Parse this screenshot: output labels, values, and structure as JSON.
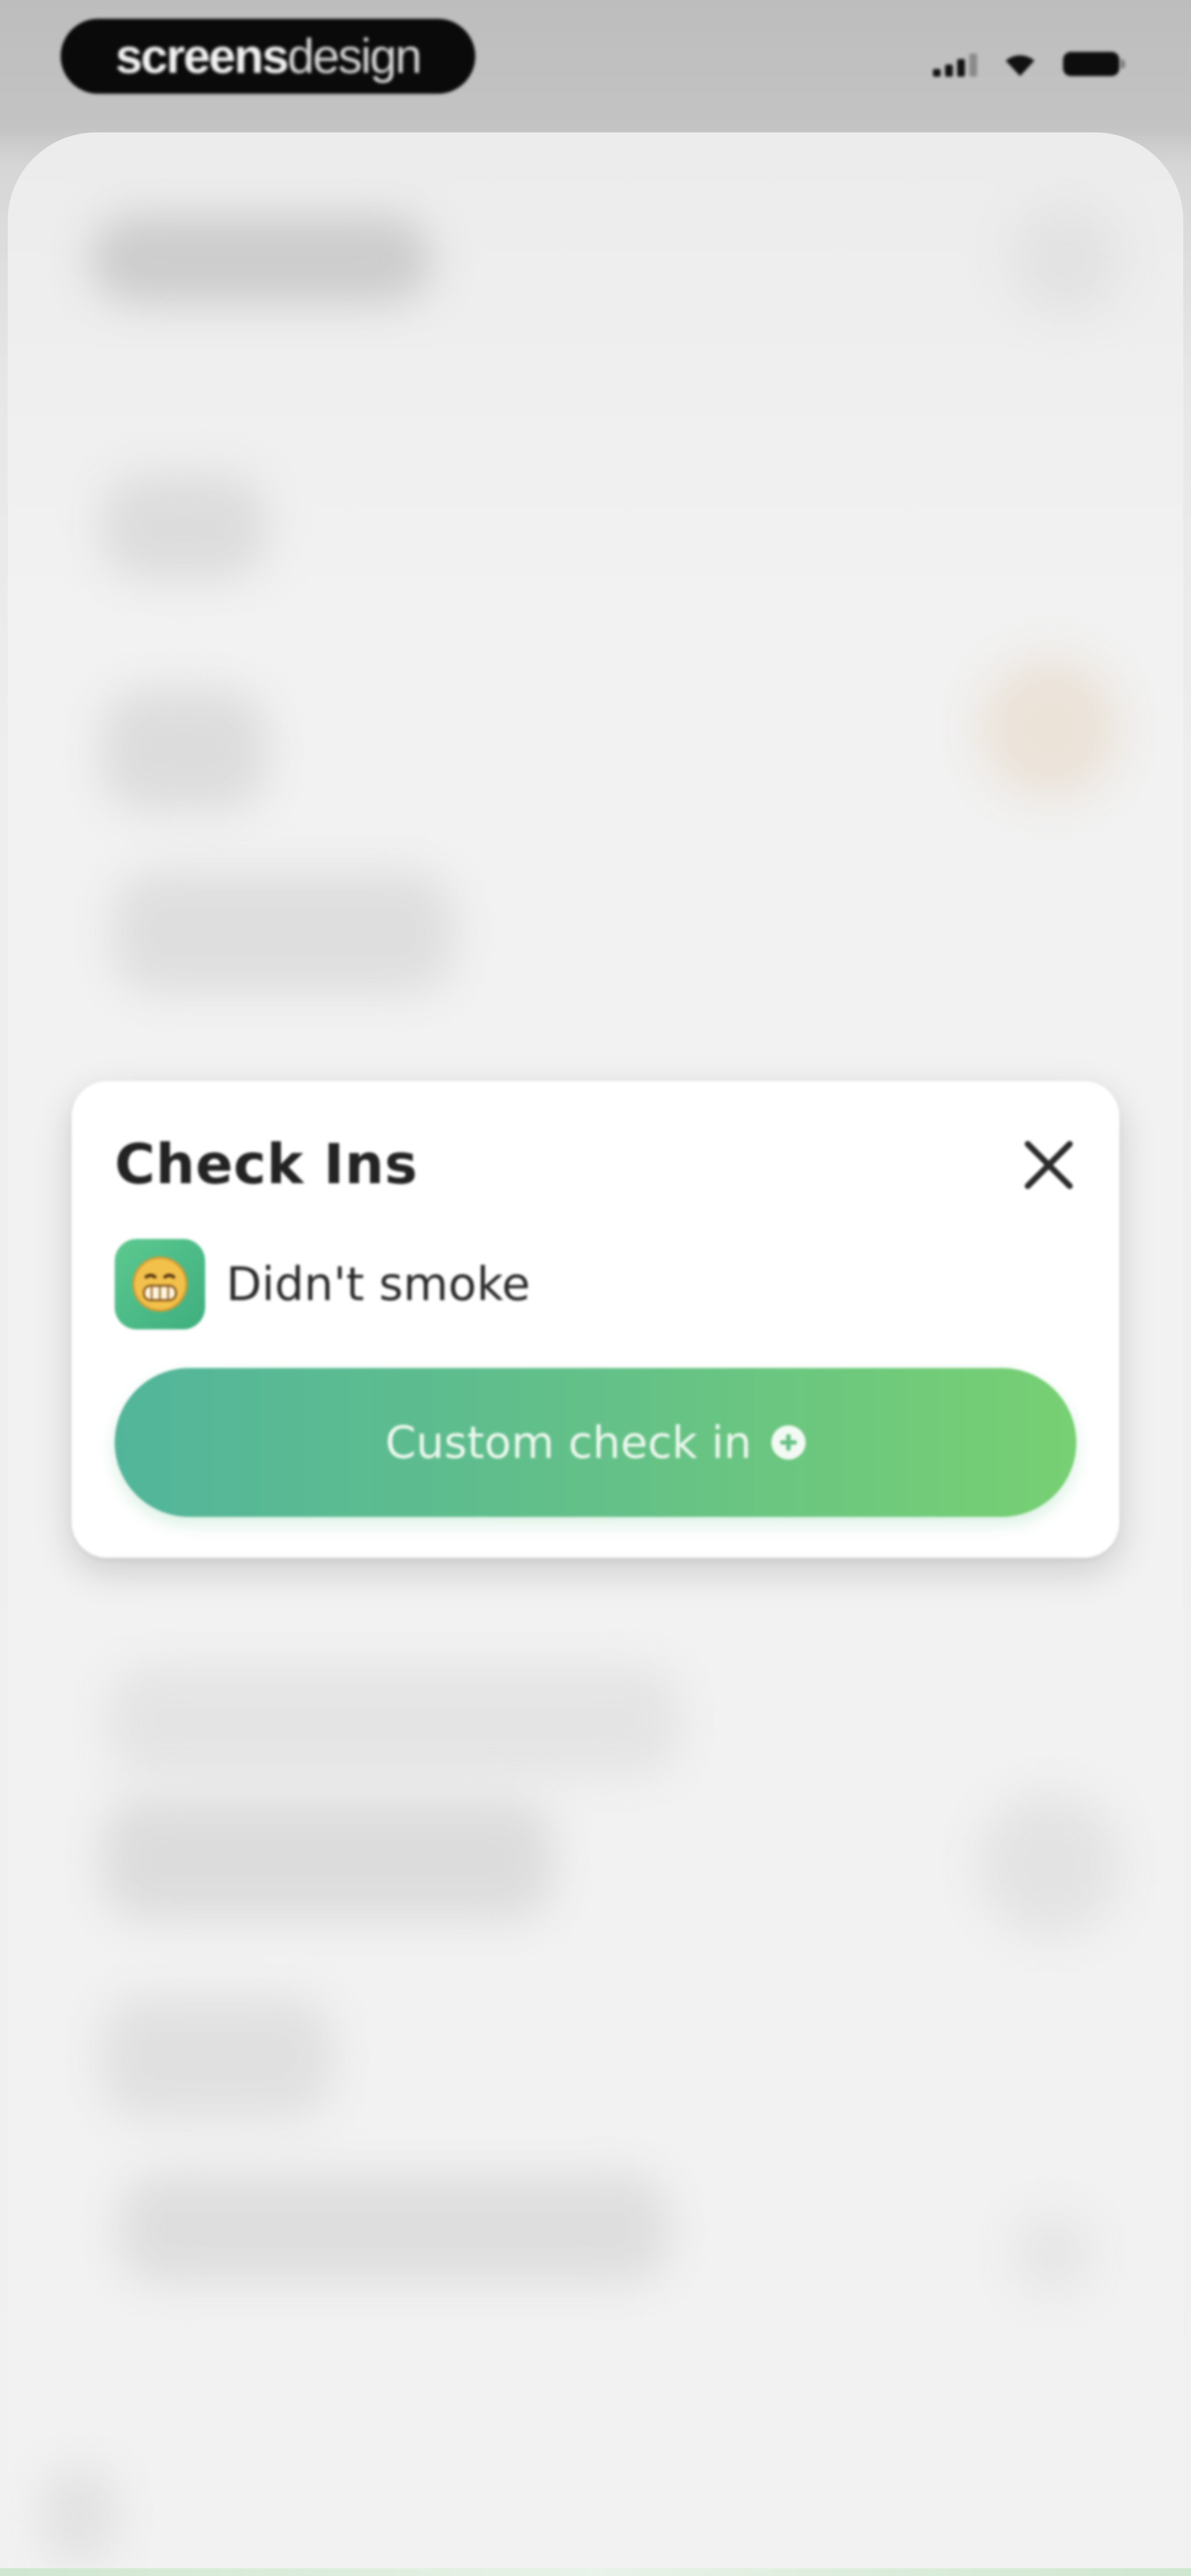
{
  "status_bar": {
    "brand_bold": "screens",
    "brand_light": "design",
    "icons": [
      "signal-icon",
      "wifi-icon",
      "battery-icon"
    ]
  },
  "modal": {
    "title": "Check Ins",
    "close_icon": "close-icon",
    "items": [
      {
        "label": "Didn't smoke",
        "icon": "grimace-emoji-icon"
      }
    ],
    "custom_button_label": "Custom check in",
    "custom_button_icon": "plus-circle-icon"
  },
  "colors": {
    "button_gradient_start": "#52b59a",
    "button_gradient_end": "#77d072",
    "item_icon_bg": "#4cbc86",
    "title_text": "#232323"
  }
}
